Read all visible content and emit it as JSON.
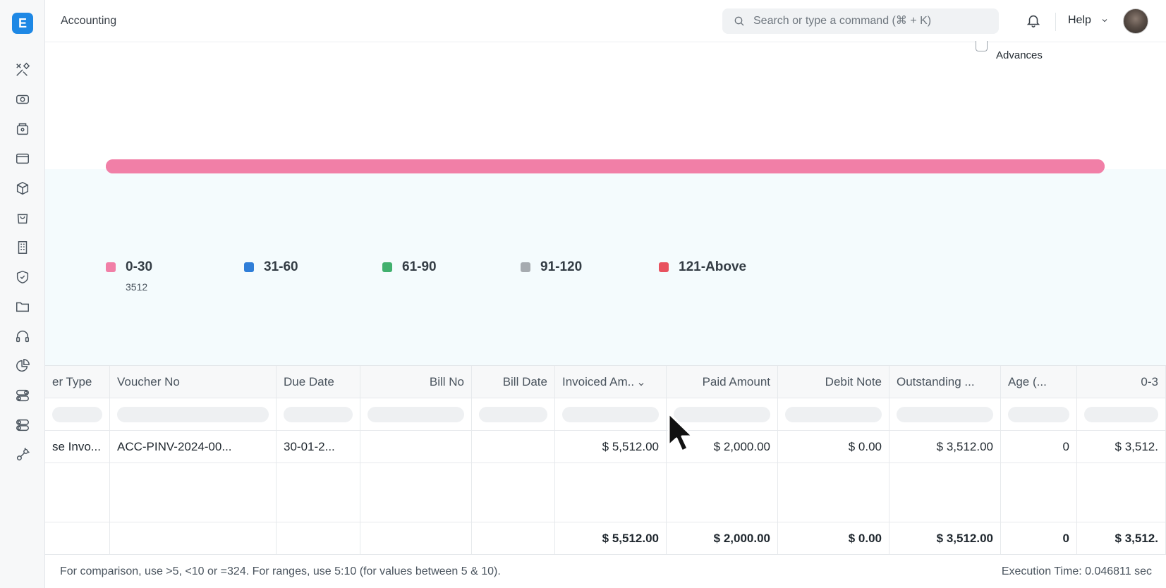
{
  "app": {
    "logo_letter": "E",
    "page_title": "Accounting"
  },
  "search": {
    "placeholder": "Search or type a command (⌘ + K)"
  },
  "header": {
    "help_label": "Help"
  },
  "sidebar": {
    "icons": [
      "tools-icon",
      "eye-icon",
      "camera-icon",
      "card-icon",
      "box-icon",
      "bag-icon",
      "building-icon",
      "shield-icon",
      "folder-icon",
      "headset-icon",
      "pie-chart-icon",
      "toggle-icon",
      "toggle-alt-icon",
      "integration-icon"
    ]
  },
  "filters": {
    "advances_label": "Advances",
    "advances_checked": false
  },
  "chart": {
    "bar_fraction_0_30": 1.0,
    "bar_color": "#f17fa7",
    "legend": [
      {
        "label": "0-30",
        "color": "#f17fa7"
      },
      {
        "label": "31-60",
        "color": "#2f7ed8"
      },
      {
        "label": "61-90",
        "color": "#41b06e"
      },
      {
        "label": "91-120",
        "color": "#a6abb0"
      },
      {
        "label": "121-Above",
        "color": "#e8525f"
      }
    ],
    "legend_value_0_30": "3512"
  },
  "table": {
    "columns": [
      "er Type",
      "Voucher No",
      "Due Date",
      "Bill No",
      "Bill Date",
      "Invoiced Am..",
      "Paid Amount",
      "Debit Note",
      "Outstanding ...",
      "Age (...",
      "0-3"
    ],
    "rows": [
      [
        "se Invo...",
        "ACC-PINV-2024-00...",
        "30-01-2...",
        "",
        "",
        "$ 5,512.00",
        "$ 2,000.00",
        "$ 0.00",
        "$ 3,512.00",
        "0",
        "$ 3,512."
      ]
    ],
    "totals": [
      "",
      "",
      "",
      "",
      "",
      "$ 5,512.00",
      "$ 2,000.00",
      "$ 0.00",
      "$ 3,512.00",
      "0",
      "$ 3,512."
    ]
  },
  "footer": {
    "hint": "For comparison, use >5, <10 or =324. For ranges, use 5:10 (for values between 5 & 10).",
    "execution_time": "Execution Time: 0.046811 sec"
  }
}
